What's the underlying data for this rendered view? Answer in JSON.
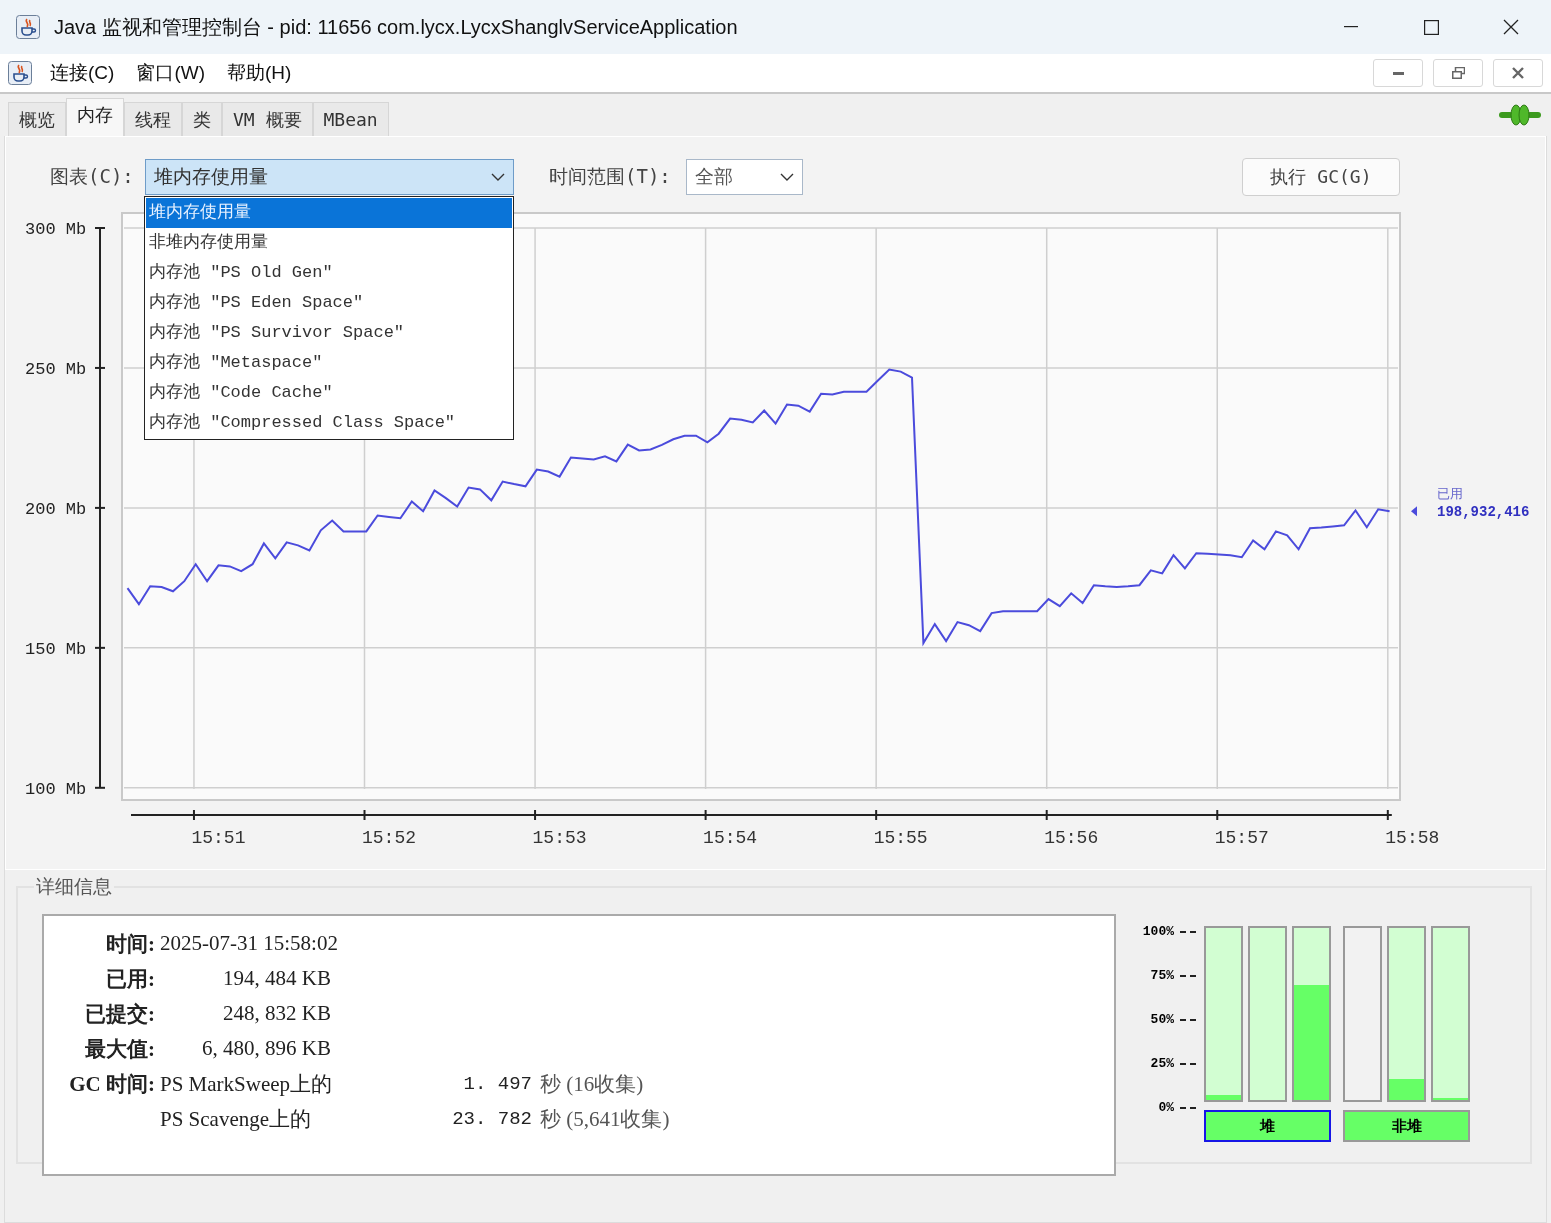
{
  "window": {
    "title": "Java 监视和管理控制台 - pid: 11656 com.lycx.LycxShanglvServiceApplication"
  },
  "menu": [
    "连接(C)",
    "窗口(W)",
    "帮助(H)"
  ],
  "tabs": [
    {
      "label": "概览",
      "selected": false
    },
    {
      "label": "内存",
      "selected": true
    },
    {
      "label": "线程",
      "selected": false
    },
    {
      "label": "类",
      "selected": false
    },
    {
      "label": "VM 概要",
      "selected": false
    },
    {
      "label": "MBean",
      "selected": false
    }
  ],
  "memory": {
    "chart_label": "图表(C):",
    "chart_select": {
      "value": "堆内存使用量",
      "expanded": true,
      "options": [
        {
          "label": "堆内存使用量",
          "selected": true
        },
        {
          "label": "非堆内存使用量",
          "selected": false
        },
        {
          "label": "内存池 \"PS Old Gen\"",
          "selected": false
        },
        {
          "label": "内存池 \"PS Eden Space\"",
          "selected": false
        },
        {
          "label": "内存池 \"PS Survivor Space\"",
          "selected": false
        },
        {
          "label": "内存池 \"Metaspace\"",
          "selected": false
        },
        {
          "label": "内存池 \"Code Cache\"",
          "selected": false
        },
        {
          "label": "内存池 \"Compressed Class Space\"",
          "selected": false
        }
      ]
    },
    "time_range_label": "时间范围(T):",
    "time_range_select": {
      "value": "全部"
    },
    "gc_button": "执行 GC(G)",
    "chart": {
      "readout": {
        "value": "198,932,416"
      },
      "chart_data": {
        "type": "line",
        "grid": true,
        "ylim": [
          96,
          305
        ],
        "categories": [
          null,
          null,
          null,
          null,
          null,
          null,
          null,
          null,
          "15:51",
          null,
          null,
          null,
          null,
          null,
          null,
          null,
          null,
          null,
          null,
          null,
          null,
          null,
          null,
          "15:52",
          null,
          null,
          null,
          null,
          null,
          null,
          null,
          null,
          null,
          null,
          null,
          null,
          null,
          null,
          "15:53",
          null,
          null,
          null,
          null,
          null,
          null,
          null,
          null,
          null,
          null,
          null,
          null,
          null,
          null,
          "15:54",
          null,
          null,
          null,
          null,
          null,
          null,
          null,
          null,
          null,
          null,
          null,
          null,
          null,
          null,
          "15:55",
          null,
          null,
          null,
          null,
          null,
          null,
          null,
          null,
          null,
          null,
          null,
          null,
          null,
          null,
          "15:56",
          null,
          null,
          null,
          null,
          null,
          null,
          null,
          null,
          null,
          null,
          null,
          null,
          null,
          null,
          "15:57",
          null,
          null,
          null,
          null,
          null,
          null,
          null,
          null,
          null,
          null,
          null,
          null,
          null,
          null,
          "15:58"
        ],
        "yticks": [
          {
            "value": 100,
            "label": "100 Mb"
          },
          {
            "value": 150,
            "label": "150 Mb"
          },
          {
            "value": 200,
            "label": "200 Mb"
          },
          {
            "value": 250,
            "label": "250 Mb"
          },
          {
            "value": 300,
            "label": "300 Mb"
          }
        ],
        "series": [
          {
            "name": "已用",
            "color": "#4b4bdc",
            "values": [
              171.3,
              165.6,
              172.0,
              171.7,
              170.2,
              173.8,
              179.9,
              173.8,
              179.5,
              179.1,
              177.4,
              179.9,
              187.3,
              182.0,
              187.7,
              186.6,
              184.8,
              192.0,
              195.5,
              191.6,
              191.6,
              191.6,
              197.3,
              196.8,
              196.3,
              202.3,
              198.8,
              206.2,
              203.5,
              200.5,
              207.3,
              206.6,
              202.7,
              209.4,
              208.5,
              207.7,
              213.7,
              213.0,
              211.2,
              218.0,
              217.6,
              217.3,
              218.4,
              216.6,
              222.6,
              220.5,
              220.9,
              222.5,
              224.5,
              225.8,
              225.8,
              223.4,
              226.5,
              231.9,
              231.5,
              230.5,
              234.8,
              230.1,
              236.9,
              236.5,
              234.4,
              240.8,
              240.5,
              241.5,
              241.5,
              241.5,
              245.5,
              249.4,
              248.7,
              246.5,
              151.7,
              158.5,
              152.4,
              159.2,
              158.1,
              156.0,
              162.4,
              163.1,
              163.1,
              163.1,
              163.1,
              167.4,
              164.9,
              169.5,
              166.0,
              172.4,
              172.0,
              171.7,
              172.0,
              172.4,
              177.7,
              176.6,
              183.1,
              178.4,
              183.8,
              183.6,
              183.4,
              183.1,
              182.4,
              188.4,
              185.2,
              191.6,
              190.2,
              185.2,
              192.7,
              193.0,
              193.4,
              193.8,
              199.1,
              193.1,
              199.5,
              198.8,
              null,
              null
            ]
          }
        ]
      }
    }
  },
  "details": {
    "title": "详细信息",
    "rows": [
      {
        "kind": "time",
        "label": "时间:",
        "value": "2025-07-31 15:58:02"
      },
      {
        "kind": "size",
        "label": "已用:",
        "value": "194, 484 KB"
      },
      {
        "kind": "size",
        "label": "已提交:",
        "value": "248, 832 KB"
      },
      {
        "kind": "size",
        "label": "最大值:",
        "value": "6, 480, 896 KB"
      }
    ],
    "gc_label": "GC 时间:",
    "gc": [
      {
        "collector": "PS MarkSweep上的",
        "time": "1. 497",
        "unit": "秒 (16收集)"
      },
      {
        "collector": "PS Scavenge上的",
        "time": "23. 782",
        "unit": "秒 (5,641收集)"
      }
    ],
    "usage": {
      "scale": [
        "100%",
        "75%",
        "50%",
        "25%",
        "0%"
      ],
      "groups": [
        {
          "label": "堆",
          "selected": true,
          "bars": [
            {
              "committed": {
                "level": 1.0
              },
              "used": {
                "level": 0.03
              }
            },
            {
              "committed": {
                "level": 1.0
              },
              "used": {
                "level": 0.0
              }
            },
            {
              "committed": {
                "level": 1.0
              },
              "used": {
                "level": 0.67
              }
            }
          ]
        },
        {
          "label": "非堆",
          "selected": false,
          "bars": [
            {
              "committed": {
                "level": 0.0
              },
              "used": {
                "level": 0.0
              }
            },
            {
              "committed": {
                "level": 1.0
              },
              "used": {
                "level": 0.12
              }
            },
            {
              "committed": {
                "level": 1.0
              },
              "used": {
                "level": 0.01
              }
            }
          ]
        }
      ]
    }
  }
}
